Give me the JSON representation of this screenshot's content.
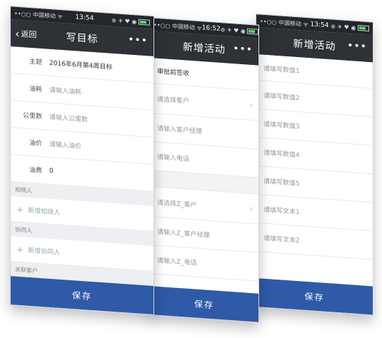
{
  "phone1": {
    "status": {
      "carrier": "••○○ 中国移动 ᯤ",
      "time": "13:54",
      "icons": "⊕ ✈ ♥ ◉"
    },
    "nav": {
      "back_label": "返回",
      "title": "写目标",
      "more": "•••"
    },
    "fields": [
      {
        "label": "主题",
        "value": "2016年6月第4周目标",
        "is_placeholder": false
      },
      {
        "label": "油耗",
        "value": "请输入油耗",
        "is_placeholder": true
      },
      {
        "label": "公里数",
        "value": "请输入公里数",
        "is_placeholder": true
      },
      {
        "label": "油价",
        "value": "请输入油价",
        "is_placeholder": true
      },
      {
        "label": "油费",
        "value": "0",
        "is_placeholder": false
      }
    ],
    "sections": {
      "notify": "知晓人",
      "add_notify": "新增知晓人",
      "collab": "协同人",
      "add_collab": "新增协同人",
      "related": "关联客户"
    },
    "save_label": "保存"
  },
  "phone2": {
    "status": {
      "carrier": "••○○ 中国移动 ᯤ",
      "time": "16:52",
      "icons": "⊕ ✈ ♥ ◉"
    },
    "nav": {
      "title": "新增活动",
      "more": "•••"
    },
    "rows": [
      "审批前签收",
      "请选择客户",
      "请输入客户经理",
      "请输入电话",
      "请选择Z_客户",
      "请输入Z_客户经理",
      "请输入Z_电话"
    ],
    "save_label": "保存"
  },
  "phone3": {
    "status": {
      "carrier": "••○○ 中国移动 ᯤ",
      "time": "13:54",
      "icons": "⊕ ✈ ♥ ◉"
    },
    "nav": {
      "title": "新增活动",
      "more": "•••"
    },
    "rows": [
      "请填写数值1",
      "请填写数值2",
      "请填写数值3",
      "请填写数值4",
      "请填写数值5",
      "请填写文本1",
      "请填写文本2"
    ],
    "save_label": "保存"
  }
}
